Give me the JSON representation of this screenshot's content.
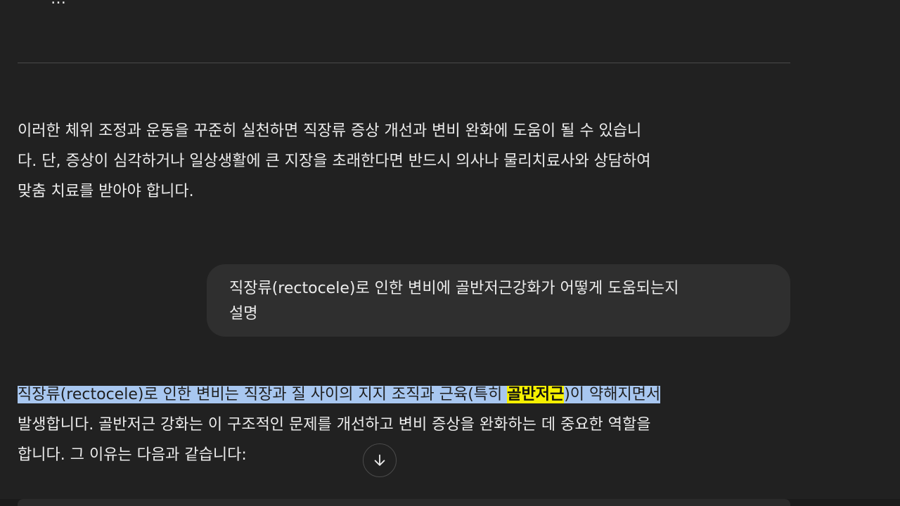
{
  "conversation": {
    "prev_truncated_line": "…",
    "assistant_paragraph_1": {
      "lines": [
        "이러한 체위 조정과 운동을 꾸준히 실천하면 직장류 증상 개선과 변비 완화에 도움이 될 수 있습니",
        "다. 단, 증상이 심각하거나 일상생활에 큰 지장을 초래한다면 반드시 의사나 물리치료사와 상담하여",
        "맞춤 치료를 받아야 합니다."
      ]
    },
    "user_message": {
      "lines": [
        "직장류(rectocele)로 인한 변비에 골반저근강화가 어떻게 도움되는지",
        "설명"
      ]
    },
    "assistant_paragraph_2": {
      "line1_before": "직장류(rectocele)로 인한 변비는 직장과 질 사이의 지지 조직과 근육(특히 ",
      "line1_highlight": "골반저근",
      "line1_after": ")이 약해지면서",
      "line2": "발생합니다. 골반저근 강화는 이 구조적인 문제를 개선하고 변비 증상을 완화하는 데 중요한 역할을",
      "line3": "합니다. 그 이유는 다음과 같습니다:"
    }
  },
  "scroll_button": {
    "icon": "arrow-down-icon"
  },
  "colors": {
    "background": "#212121",
    "user_bubble": "#2f2f2f",
    "selection": "#a8c7f0",
    "highlight": "#f5f000"
  }
}
